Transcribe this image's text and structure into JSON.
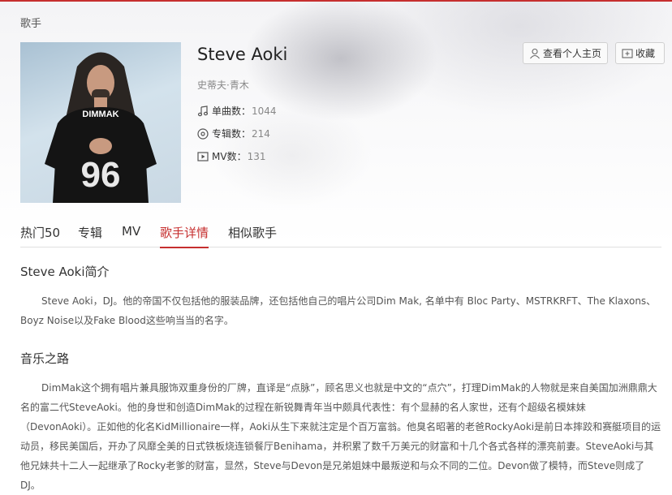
{
  "breadcrumb": "歌手",
  "artist": {
    "name": "Steve Aoki",
    "alias": "史蒂夫·青木",
    "shirt_text": "DIMMAK",
    "shirt_number": "96"
  },
  "stats": {
    "songs_label": "单曲数：",
    "songs_value": "1044",
    "albums_label": "专辑数：",
    "albums_value": "214",
    "mv_label": "MV数：",
    "mv_value": "131"
  },
  "actions": {
    "homepage_label": "查看个人主页",
    "collect_label": "收藏"
  },
  "tabs": [
    {
      "label": "热门50"
    },
    {
      "label": "专辑"
    },
    {
      "label": "MV"
    },
    {
      "label": "歌手详情"
    },
    {
      "label": "相似歌手"
    }
  ],
  "active_tab": "歌手详情",
  "intro": {
    "title": "Steve Aoki简介",
    "text": "Steve Aoki，DJ。他的帝国不仅包括他的服装品牌，还包括他自己的唱片公司Dim Mak, 名单中有 Bloc Party、MSTRKRFT、The Klaxons、Boyz Noise以及Fake Blood这些响当当的名字。"
  },
  "music": {
    "title": "音乐之路",
    "text": "DimMak这个拥有唱片兼具服饰双重身份的厂牌，直译是“点脉”，顾名思义也就是中文的“点穴”，打理DimMak的人物就是来自美国加洲鼎鼎大名的富二代SteveAoki。他的身世和创造DimMak的过程在新锐舞青年当中颇具代表性：有个显赫的名人家世，还有个超级名模妹妹（DevonAoki）。正如他的化名KidMillionaire一样，Aoki从生下来就注定是个百万富翁。他臭名昭著的老爸RockyAoki是前日本摔跤和赛艇项目的运动员，移民美国后，开办了风靡全美的日式铁板烧连锁餐厅Benihama，并积累了数千万美元的财富和十几个各式各样的漂亮前妻。SteveAoki与其他兄妹共十二人一起继承了Rocky老爹的财富，显然，Steve与Devon是兄弟姐妹中最叛逆和与众不同的二位。Devon做了模特，而Steve则成了DJ。"
  },
  "colors": {
    "accent": "#c62f2f",
    "text": "#333333",
    "muted": "#888888"
  },
  "icons": {
    "songs": "music-note-icon",
    "albums": "disc-icon",
    "mv": "play-icon",
    "homepage": "user-icon",
    "collect": "add-folder-icon"
  }
}
